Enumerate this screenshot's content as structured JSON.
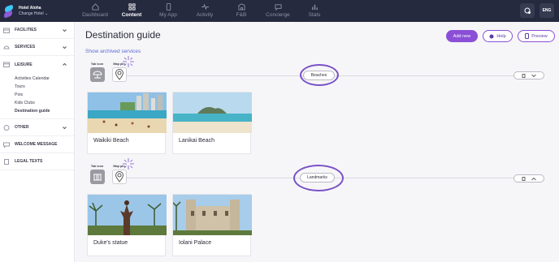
{
  "app": {
    "hotel_name": "Hotel Aloha",
    "change_hotel": "Change Hotel"
  },
  "nav": [
    {
      "label": "Dashboard",
      "icon": "home-icon"
    },
    {
      "label": "Content",
      "icon": "grid-icon",
      "active": true
    },
    {
      "label": "My App",
      "icon": "phone-icon"
    },
    {
      "label": "Activity",
      "icon": "pulse-icon"
    },
    {
      "label": "F&B",
      "icon": "building-icon"
    },
    {
      "label": "Concierge",
      "icon": "chat-icon"
    },
    {
      "label": "Stats",
      "icon": "bar-chart-icon"
    }
  ],
  "topbar": {
    "lang": "ENG"
  },
  "sidebar": {
    "facilities": "FACILITIES",
    "services": "SERVICES",
    "leisure": "LEISURE",
    "leisure_items": [
      "Activities Calendar",
      "Tours",
      "Pois",
      "Kids Clubs",
      "Destination guide"
    ],
    "other": "OTHER",
    "welcome": "WELCOME MESSAGE",
    "legal": "LEGAL TEXTS"
  },
  "main": {
    "title": "Destination guide",
    "archived": "Show archived services",
    "add_new": "Add new",
    "help": "Help",
    "preview": "Preview"
  },
  "groups": [
    {
      "tab_icon_label": "Tab icon",
      "map_pin_label": "Map pin",
      "name": "Beaches",
      "cards": [
        {
          "caption": "Waikiki Beach"
        },
        {
          "caption": "Lanikai Beach"
        }
      ]
    },
    {
      "tab_icon_label": "Tab icon",
      "map_pin_label": "Map pin",
      "name": "Landmarks",
      "cards": [
        {
          "caption": "Duke's statue"
        },
        {
          "caption": "Iolani Palace"
        }
      ]
    }
  ],
  "colors": {
    "topbar": "#262a3f",
    "accent": "#8a4fd6",
    "link": "#5d6bd3",
    "highlight_circle": "#7a52c8"
  }
}
